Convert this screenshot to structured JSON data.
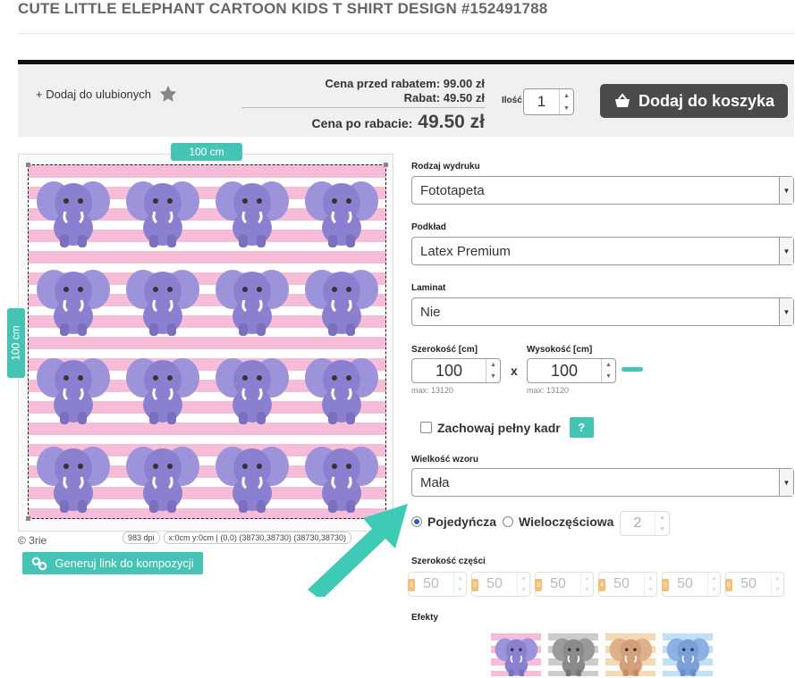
{
  "page": {
    "title": "CUTE LITTLE ELEPHANT CARTOON KIDS T SHIRT DESIGN #152491788"
  },
  "buybar": {
    "favorite_label": "+ Dodaj do ulubionych",
    "price_before_label": "Cena przed rabatem:",
    "price_before_value": "99.00 zł",
    "discount_label": "Rabat:",
    "discount_value": "49.50 zł",
    "final_label": "Cena po rabacie:",
    "final_value": "49.50 zł",
    "quantity_label": "Ilość",
    "quantity_value": "1",
    "add_to_cart_label": "Dodaj do koszyka"
  },
  "preview": {
    "width_label": "100 cm",
    "height_label": "100 cm",
    "copyright": "© 3rie",
    "dpi": "983 dpi",
    "coords": "x:0cm y:0cm | (0,0) (38730,38730) (38730,38730)",
    "generate_link_label": "Generuj link do kompozycji"
  },
  "form": {
    "print_type_label": "Rodzaj wydruku",
    "print_type_value": "Fototapeta",
    "base_label": "Podkład",
    "base_value": "Latex Premium",
    "laminate_label": "Laminat",
    "laminate_value": "Nie",
    "width_label": "Szerokość [cm]",
    "width_value": "100",
    "width_max": "max: 13120",
    "height_label": "Wysokość [cm]",
    "height_value": "100",
    "height_max": "max: 13120",
    "times_sign": "x",
    "keep_frame_label": "Zachowaj pełny kadr",
    "help_label": "?",
    "pattern_size_label": "Wielkość wzoru",
    "pattern_size_value": "Mała",
    "single_label": "Pojedyńcza",
    "multi_label": "Wieloczęściowa",
    "parts_count": "2",
    "part_width_label": "Szerokość części",
    "parts": [
      {
        "tag": "1",
        "value": "50"
      },
      {
        "tag": "2",
        "value": "50"
      },
      {
        "tag": "3",
        "value": "50"
      },
      {
        "tag": "4",
        "value": "50"
      },
      {
        "tag": "5",
        "value": "50"
      },
      {
        "tag": "6",
        "value": "50"
      }
    ],
    "effects_label": "Efekty"
  },
  "colors": {
    "accent": "#45c3b4",
    "elephant": "#8b80cf",
    "stripe": "#f7bcd8",
    "cart": "#4a4a4a"
  }
}
